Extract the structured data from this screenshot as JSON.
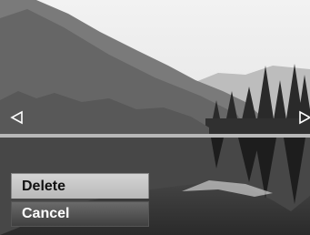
{
  "preview": {
    "image": "lake-forest-mountain-photo"
  },
  "nav": {
    "prev_icon": "left-triangle-icon",
    "next_icon": "right-triangle-icon"
  },
  "menu": {
    "items": [
      {
        "label": "Delete",
        "selected": false
      },
      {
        "label": "Cancel",
        "selected": true
      }
    ]
  }
}
